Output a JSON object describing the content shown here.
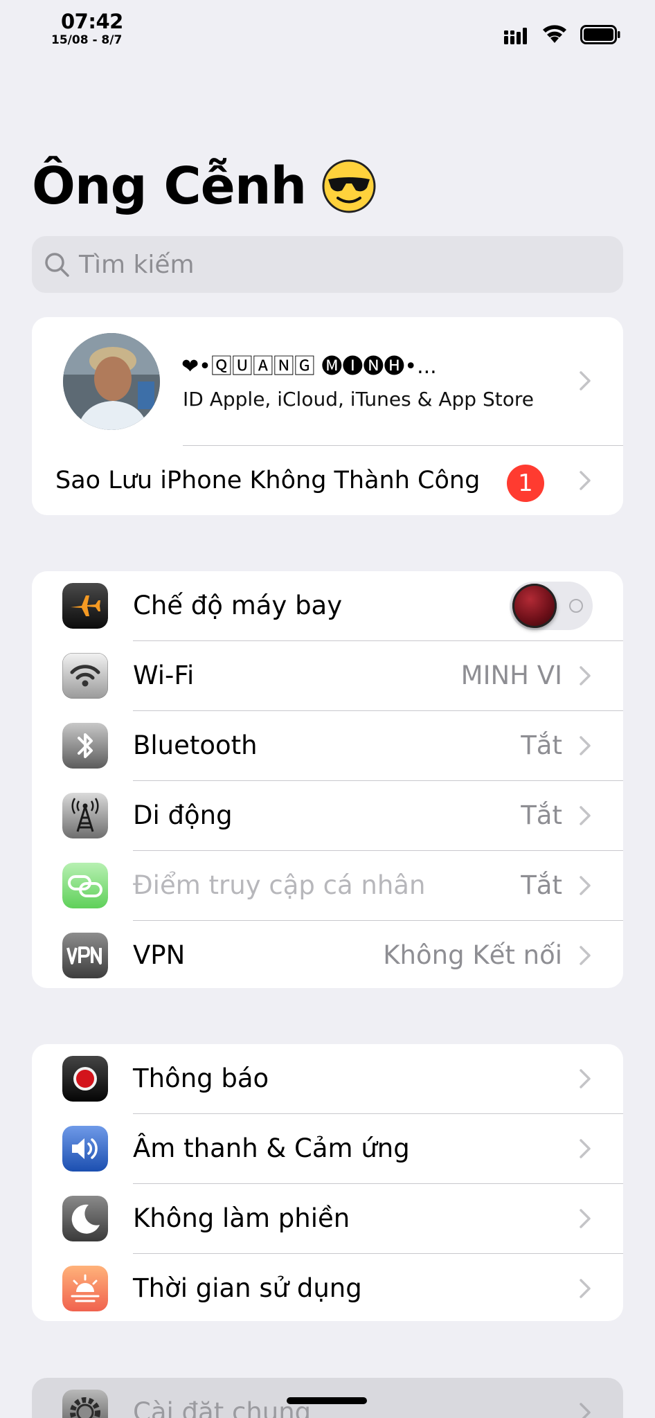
{
  "status_bar": {
    "time": "07:42",
    "date": "15/08 - 8/7",
    "icons": [
      "signal-icon",
      "wifi-icon",
      "battery-icon"
    ]
  },
  "title": {
    "text": "Ông Cễnh",
    "emoji_icon": "sunglasses-emoji-icon"
  },
  "search": {
    "placeholder": "Tìm kiếm"
  },
  "profile": {
    "name": "❤•🅀🅄🄰🄽🄶 🅜🅘🅝🅗•...",
    "subtitle": "ID Apple, iCloud, iTunes & App Store",
    "avatar_icon": "profile-photo"
  },
  "backup": {
    "label": "Sao Lưu iPhone Không Thành Công",
    "badge_count": "1"
  },
  "network": [
    {
      "label": "Chế độ máy bay",
      "icon": "airplane-icon",
      "toggle": "on"
    },
    {
      "label": "Wi-Fi",
      "icon": "wifi-settings-icon",
      "value": "MINH VI"
    },
    {
      "label": "Bluetooth",
      "icon": "bluetooth-icon",
      "value": "Tắt"
    },
    {
      "label": "Di động",
      "icon": "cellular-antenna-icon",
      "value": "Tắt"
    },
    {
      "label": "Điểm truy cập cá nhân",
      "icon": "hotspot-icon",
      "value": "Tắt",
      "disabled": true
    },
    {
      "label": "VPN",
      "icon": "vpn-icon",
      "value": "Không Kết nối"
    }
  ],
  "notifications_group": [
    {
      "label": "Thông báo",
      "icon": "notifications-icon"
    },
    {
      "label": "Âm thanh & Cảm ứng",
      "icon": "sound-icon"
    },
    {
      "label": "Không làm phiền",
      "icon": "moon-icon"
    },
    {
      "label": "Thời gian sử dụng",
      "icon": "screen-time-icon"
    }
  ],
  "general": {
    "label": "Cài đặt chung",
    "icon": "gear-icon"
  },
  "colors": {
    "background": "#efeff4",
    "badge": "#ff3b30",
    "secondary_text": "#8e8e93"
  }
}
